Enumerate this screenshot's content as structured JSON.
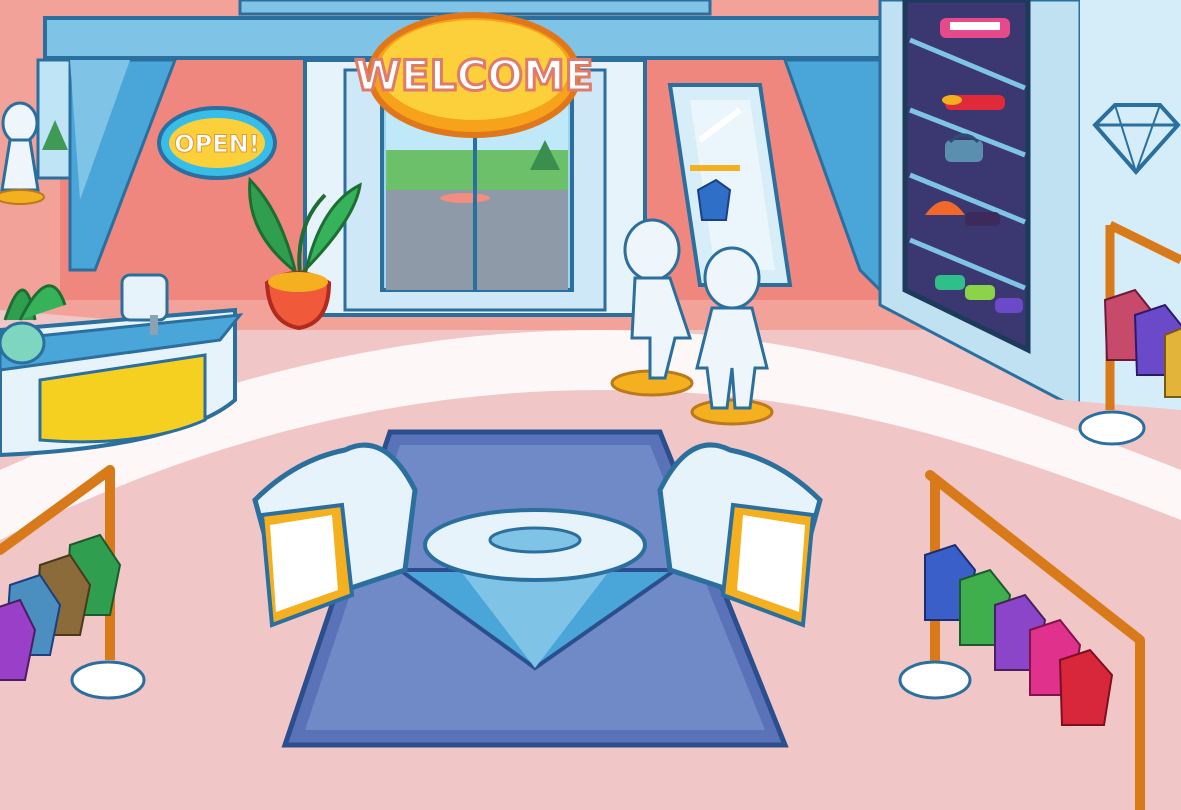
{
  "scene": {
    "signs": {
      "welcome": "WELCOME",
      "open": "OPEN!"
    },
    "colors": {
      "floor": "#f1c6c6",
      "wall": "#f0877f",
      "frame": "#7fc3e6",
      "frame_dark": "#2b6f9e",
      "rug": "#5a73b8",
      "gold": "#f5b020",
      "welcome_sign": "#f7a21b",
      "open_sign": "#38bde8"
    },
    "hangers": {
      "left_rack_colors": [
        "#2f9e4e",
        "#8c6b3a",
        "#4a8fc0",
        "#9a3fc8"
      ],
      "right_rack_colors": [
        "#3a5fc8",
        "#3fae4d",
        "#8b45c9",
        "#e0318d",
        "#d8263a"
      ],
      "back_rack_colors": [
        "#c84a6a",
        "#6a4ac8",
        "#e3b43a"
      ]
    },
    "shelf_items": [
      "sneakers",
      "flats",
      "bag",
      "cap",
      "shoes",
      "sneakers-row"
    ],
    "icons": [
      "diamond-icon"
    ]
  }
}
